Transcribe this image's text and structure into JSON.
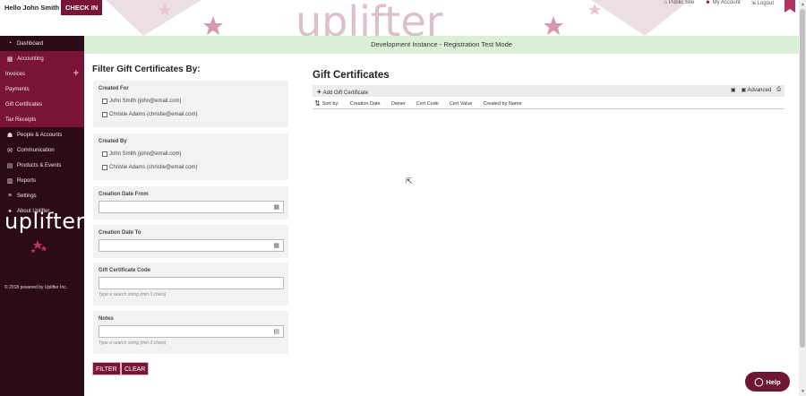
{
  "header": {
    "greeting": "Hello John Smith",
    "checkin_label": "CHECK IN",
    "links": [
      "Public Site",
      "My Account",
      "Logout"
    ],
    "watermark": "uplifter",
    "accent": "#7a1437"
  },
  "banner": "Development Instance - Registration Test Mode",
  "sidebar": {
    "items": [
      {
        "label": "Dashboard",
        "icon": "dashboard-icon",
        "glyph": "◔"
      },
      {
        "label": "Accounting",
        "icon": "calculator-icon",
        "glyph": "▦"
      },
      {
        "label": "Invoices",
        "icon": "",
        "glyph": ""
      },
      {
        "label": "Payments",
        "icon": "",
        "glyph": ""
      },
      {
        "label": "Gift Certificates",
        "icon": "",
        "glyph": ""
      },
      {
        "label": "Tax Receipts",
        "icon": "",
        "glyph": ""
      },
      {
        "label": "People & Accounts",
        "icon": "people-icon",
        "glyph": "☗"
      },
      {
        "label": "Communication",
        "icon": "communication-icon",
        "glyph": "✉"
      },
      {
        "label": "Products & Events",
        "icon": "products-icon",
        "glyph": "▤"
      },
      {
        "label": "Reports",
        "icon": "chart-icon",
        "glyph": "▥"
      },
      {
        "label": "Settings",
        "icon": "settings-icon",
        "glyph": "≡"
      },
      {
        "label": "About Uplifter",
        "icon": "info-icon",
        "glyph": "✦"
      }
    ],
    "logo_text": "uplifter",
    "copyright": "© 2018 powered by Uplifter Inc."
  },
  "filter": {
    "title": "Filter Gift Certificates By:",
    "created_for_label": "Created For",
    "created_for_options": [
      "John Smith (john@email.com)",
      "Christie Adams (christie@email.com)"
    ],
    "created_by_label": "Created By",
    "created_by_options": [
      "John Smith (john@email.com)",
      "Christie Adams (christie@email.com)"
    ],
    "date_from_label": "Creation Date From",
    "date_to_label": "Creation Date To",
    "code_label": "Gift Certificate Code",
    "code_hint": "Type a search string (min 3 chars)",
    "notes_label": "Notes",
    "notes_hint": "Type a search string (min 3 chars)",
    "filter_button": "FILTER",
    "clear_button": "CLEAR"
  },
  "gift_certificates": {
    "title": "Gift Certificates",
    "add_label": "Add Gift Certificate",
    "advanced_label": "Advanced",
    "sort_label": "Sort by:",
    "sort_columns": [
      "Creation Date",
      "Owner",
      "Cert Code",
      "Cert Value",
      "Created by Name"
    ]
  },
  "help_label": "Help"
}
